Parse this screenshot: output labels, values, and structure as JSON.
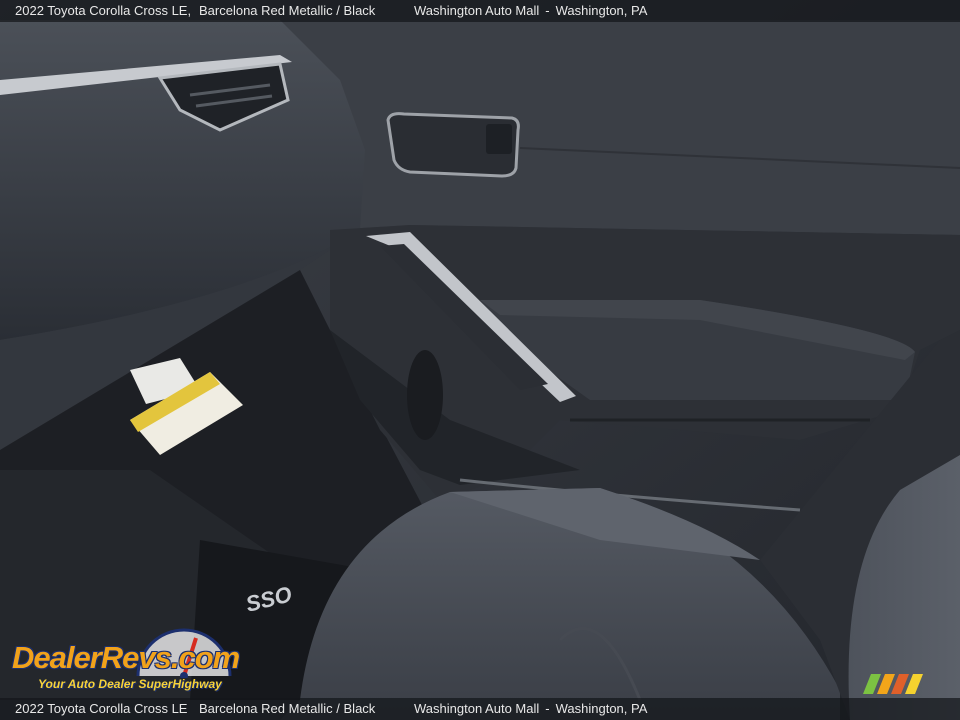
{
  "caption": {
    "vehicle": "2022 Toyota Corolla Cross LE,",
    "color": "Barcelona Red Metallic / Black",
    "dealer": "Washington Auto Mall",
    "separator": "-",
    "location": "Washington, PA"
  },
  "caption_bottom": {
    "vehicle": "2022 Toyota Corolla Cross LE",
    "color": "Barcelona Red Metallic / Black",
    "dealer": "Washington Auto Mall",
    "separator": "-",
    "location": "Washington, PA"
  },
  "watermark": {
    "brand": "DealerRevs.com",
    "tagline": "Your Auto Dealer SuperHighway"
  },
  "floor_mat_text": "SSO",
  "colors": {
    "caption_bg": "#14161a",
    "caption_text": "#e8e8e8",
    "logo_orange": "#f1a21b",
    "logo_blue": "#1c2f6e",
    "interior_dark": "#1e2126",
    "interior_mid": "#3a3e45",
    "trim_silver": "#b9bcc1",
    "seat_fabric": "#4a4e56"
  }
}
